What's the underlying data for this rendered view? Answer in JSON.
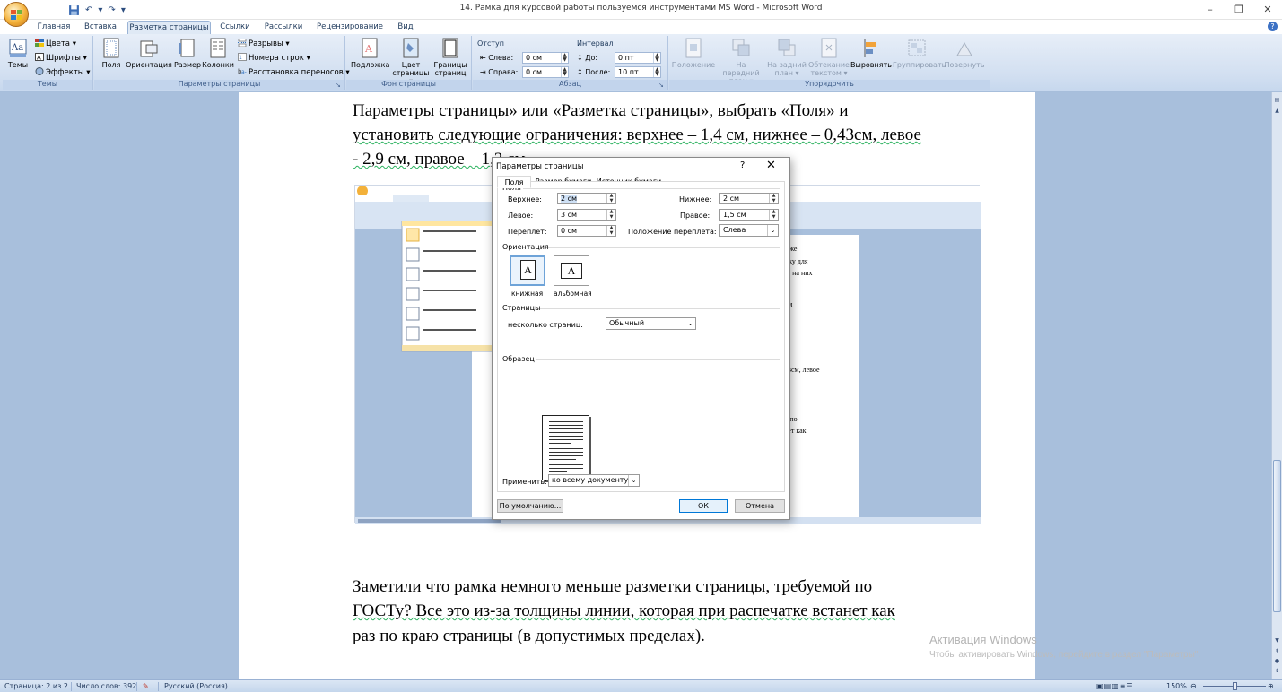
{
  "window": {
    "title": "14. Рамка для курсовой работы пользуемся инструментами MS Word - Microsoft Word",
    "controls": [
      "–",
      "❐",
      "✕"
    ]
  },
  "qat": {
    "undo": "↶",
    "redo": "↷",
    "more": "▾"
  },
  "tabs": [
    "Главная",
    "Вставка",
    "Разметка страницы",
    "Ссылки",
    "Рассылки",
    "Рецензирование",
    "Вид"
  ],
  "active_tab": "Разметка страницы",
  "ribbon": {
    "themes": {
      "label": "Темы",
      "big": "Темы",
      "colors": "Цвета ▾",
      "fonts": "Шрифты ▾",
      "effects": "Эффекты ▾"
    },
    "page_setup": {
      "label": "Параметры страницы",
      "margins": "Поля",
      "orientation": "Ориентация",
      "size": "Размер",
      "columns": "Колонки",
      "breaks": "Разрывы ▾",
      "line_numbers": "Номера строк ▾",
      "hyphenation": "Расстановка переносов ▾"
    },
    "page_bg": {
      "label": "Фон страницы",
      "watermark": "Подложка",
      "page_color_1": "Цвет",
      "page_color_2": "страницы ▾",
      "borders_1": "Границы",
      "borders_2": "страниц"
    },
    "paragraph": {
      "label": "Абзац",
      "indent": "Отступ",
      "spacing": "Интервал",
      "left_label": "Слева:",
      "left_val": "0 см",
      "right_label": "Справа:",
      "right_val": "0 см",
      "before_label": "До:",
      "before_val": "0 пт",
      "after_label": "После:",
      "after_val": "10 пт"
    },
    "arrange": {
      "label": "Упорядочить",
      "position": "Положение",
      "front_1": "На передний",
      "front_2": "план ▾",
      "back_1": "На задний",
      "back_2": "план ▾",
      "wrap_1": "Обтекание",
      "wrap_2": "текстом ▾",
      "align": "Выровнять",
      "group": "Группировать",
      "rotate": "Повернуть"
    }
  },
  "document": {
    "lines": [
      "Параметры страницы» или «Разметка страницы», выбрать «Поля» и",
      "установить следующие ограничения: верхнее – 1,4 см, нижнее – 0,43см, левое",
      "- 2,9 см, правое – 1,3 см."
    ],
    "lines_bottom": [
      "Заметили что рамка немного меньше разметки страницы, требуемой по",
      "ГОСТу? Все это из-за толщины линии, которая при распечатке встанет как",
      "раз по краю страницы (в допустимых пределах)."
    ],
    "embedded_text": [
      "т же",
      "мку для",
      "ть на них",
      "им",
      "3см, левое",
      "й по",
      "нет как"
    ]
  },
  "activation": {
    "title": "Активация Windows",
    "text": "Чтобы активировать Windows, перейдите в раздел \"Параметры\"."
  },
  "dialog": {
    "title": "Параметры страницы",
    "help": "?",
    "close": "✕",
    "tabs": [
      "Поля",
      "Размер бумаги",
      "Источник бумаги"
    ],
    "margins_section": "Поля",
    "top_label": "Верхнее:",
    "top_val": "2 см",
    "bottom_label": "Нижнее:",
    "bottom_val": "2 см",
    "left_label": "Левое:",
    "left_val": "3 см",
    "right_label": "Правое:",
    "right_val": "1,5 см",
    "gutter_label": "Переплет:",
    "gutter_val": "0 см",
    "gutter_pos_label": "Положение переплета:",
    "gutter_pos_val": "Слева",
    "orientation_section": "Ориентация",
    "portrait": "книжная",
    "landscape": "альбомная",
    "pages_section": "Страницы",
    "multiple_label": "несколько страниц:",
    "multiple_val": "Обычный",
    "preview_section": "Образец",
    "apply_label": "Применить:",
    "apply_val": "ко всему документу",
    "default_btn": "По умолчанию...",
    "ok_btn": "ОК",
    "cancel_btn": "Отмена"
  },
  "status": {
    "page": "Страница: 2 из 2",
    "words": "Число слов: 392",
    "language": "Русский (Россия)",
    "zoom": "150%"
  }
}
